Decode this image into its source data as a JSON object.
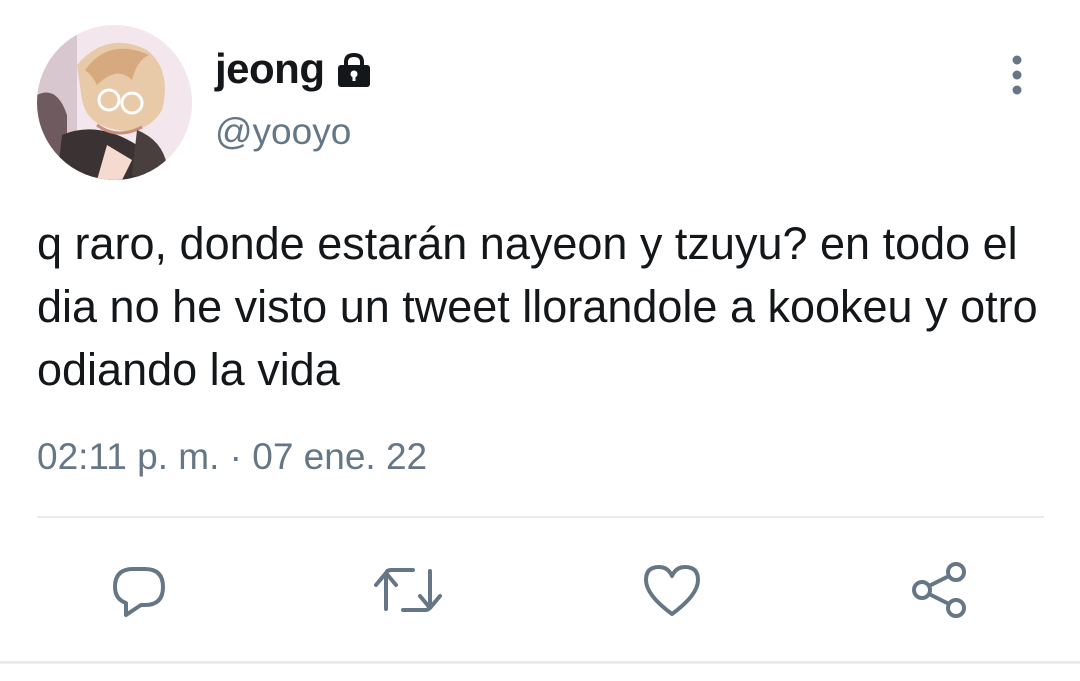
{
  "tweet": {
    "author": {
      "display_name": "jeong",
      "handle": "@yooyo",
      "avatar_icon": "avatar-illustration",
      "protected_icon": "lock-icon"
    },
    "text": "q raro, donde estarán nayeon y tzuyu? en todo el dia no he visto un tweet llorandole a kookeu y otro odiando la vida",
    "timestamp": "02:11 p. m. · 07 ene. 22",
    "menu_icon": "more-vertical-icon"
  },
  "actions": [
    {
      "name": "reply",
      "icon": "reply-icon"
    },
    {
      "name": "retweet",
      "icon": "retweet-icon"
    },
    {
      "name": "like",
      "icon": "heart-icon"
    },
    {
      "name": "share",
      "icon": "share-icon"
    }
  ],
  "colors": {
    "text_primary": "#14171a",
    "text_secondary": "#657786",
    "icon": "#657786",
    "divider": "#e6ecf0",
    "background": "#ffffff"
  }
}
